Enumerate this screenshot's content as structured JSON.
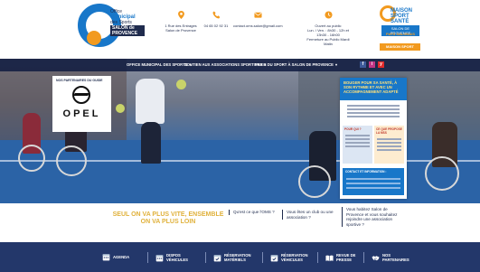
{
  "header": {
    "logo": {
      "line1": "Office",
      "line2": "Municipal",
      "line3": "des Sports",
      "line4": "SALON de PROVENCE"
    },
    "address": "1 Rue des Entrages\nSalon de Provence",
    "phone": "04 65 02 92 31",
    "email": "contact.oms.salon@gmail.com",
    "hours": "Ouvert au public\nLun. / Ven. : 8h30 - 12h et 13h30 - 16h00\nFermeture au Public Mardi Matin",
    "sport_badge": {
      "title": "MAISON SPORT SANTÉ",
      "subtitle": "SALON DE PROVENCE",
      "location": "PAYS SALONAIS"
    },
    "cta_button": "MAISON SPORT SANTÉ"
  },
  "nav": {
    "items": [
      {
        "label": "OFFICE MUNICIPAL DES SPORTS"
      },
      {
        "label": "SOUTIEN AUX ASSOCIATIONS SPORTIVES"
      },
      {
        "label": "PARIS DU SPORT À SALON DE PROVENCE"
      }
    ],
    "social": [
      "f",
      "i",
      "y"
    ]
  },
  "hero": {
    "partner": {
      "caption": "NOS PARTENAIRES DU GUIDE",
      "brand": "OPEL"
    },
    "promo": {
      "headline": "BOUGER POUR SA SANTÉ, À SON RYTHME ET AVEC UN ACCOMPAGNEMENT ADAPTÉ",
      "col_a_title": "POUR QUI ?",
      "col_b_title": "CE QUE PROPOSE LA MSS",
      "contact_title": "CONTACT ET INFORMATION :"
    }
  },
  "band": {
    "tagline": "SEUL ON VA PLUS VITE, ENSEMBLE ON VA PLUS LOIN",
    "q1": "Qu'est ce que l'OMS ?",
    "q2": "Vous êtes un club ou une association ?",
    "q3": "Vous habitez Salon de Provence et vous souhaitez rejoindre une association sportive ?"
  },
  "footer": {
    "items": [
      {
        "label": "AGENDA",
        "icon": "calendar-icon"
      },
      {
        "label": "DISPOS\nVÉHICULES",
        "icon": "calendar-icon"
      },
      {
        "label": "RÉSERVATION\nMATÉRIELS",
        "icon": "calendar-check-icon"
      },
      {
        "label": "RÉSERVATION\nVÉHICULES",
        "icon": "calendar-check-icon"
      },
      {
        "label": "REVUE DE\nPRESSE",
        "icon": "book-icon"
      },
      {
        "label": "NOS\nPARTENAIRES",
        "icon": "handshake-icon"
      }
    ]
  },
  "colors": {
    "navy": "#23376a",
    "blue": "#1877c9",
    "orange": "#f29a1f",
    "gold": "#e0b13b"
  }
}
